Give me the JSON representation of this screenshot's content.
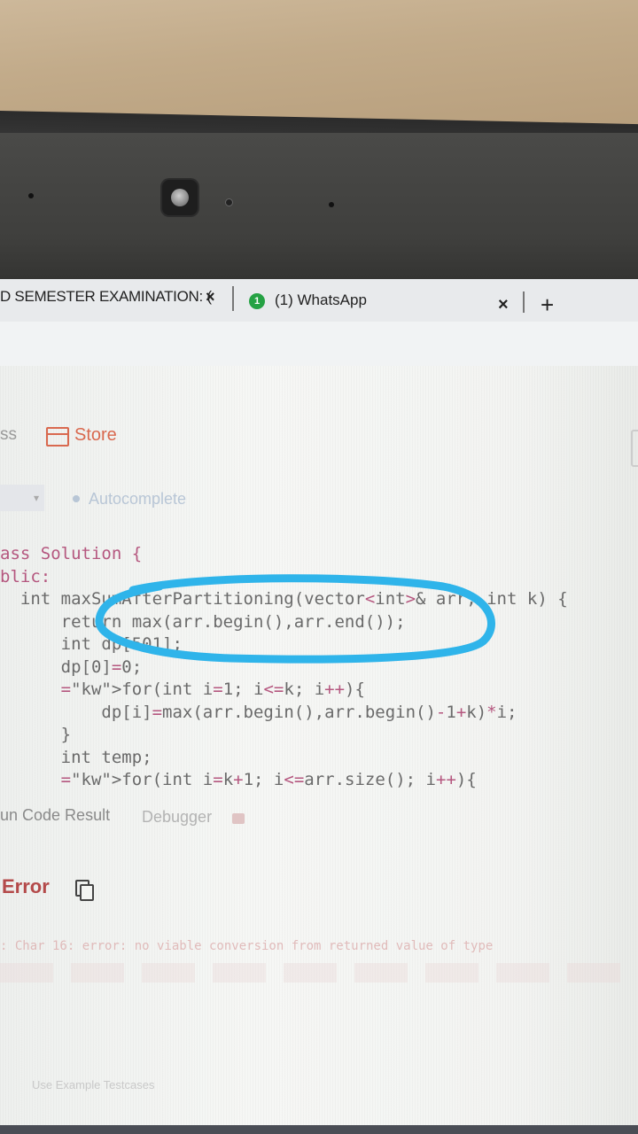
{
  "browser": {
    "tabs": [
      {
        "label": "D SEMESTER EXAMINATION: (",
        "close": "×"
      },
      {
        "label": "(1) WhatsApp",
        "badge": "1",
        "close": "×"
      }
    ],
    "new_tab": "+"
  },
  "toolbar": {
    "left_fragment": "ss",
    "store_label": "Store",
    "autocomplete_label": "Autocomplete",
    "lang_dropdown_arrow": "▾"
  },
  "editor": {
    "lines": [
      "ass Solution {",
      "blic:",
      "  int maxSumAfterPartitioning(vector<int>& arr, int k) {",
      "      return max(arr.begin(),arr.end());",
      "      int dp[501];",
      "      dp[0]=0;",
      "      for(int i=1; i<=k; i++){",
      "          dp[i]=max(arr.begin(),arr.begin()-1+k)*i;",
      "      }",
      "      int temp;",
      "      for(int i=k+1; i<=arr.size(); i++){"
    ]
  },
  "result_tabs": {
    "run_code_result": "un Code Result",
    "debugger": "Debugger"
  },
  "result": {
    "status": "Error",
    "message": ": Char 16: error: no viable conversion from returned value of type",
    "footer": "Use Example Testcases"
  },
  "colors": {
    "annotation": "#2fb4ea",
    "store": "#d9694f",
    "error": "#b44a4a",
    "keyword": "#2f6fae"
  }
}
